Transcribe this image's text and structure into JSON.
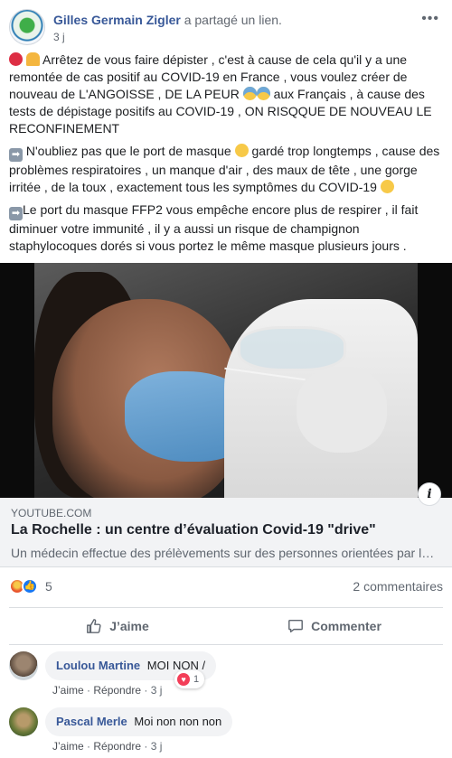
{
  "post": {
    "author": "Gilles Germain Zigler",
    "action": "a partagé un lien.",
    "time": "3 j",
    "paragraphs": [
      "Arrêtez de vous faire dépister , c'est à cause de cela qu'il y a une remontée de cas positif au COVID-19 en France , vous voulez créer de nouveau de L'ANGOISSE , DE LA PEUR",
      "aux Français , à cause des tests de dépistage positifs au COVID-19 , ON RISQQUE DE NOUVEAU LE RECONFINEMENT",
      "N'oubliez pas que le port de masque",
      "gardé trop longtemps , cause des problèmes respiratoires , un manque d'air , des maux de tête , une gorge irritée , de la toux , exactement tous les symptômes du COVID-19",
      "Le port du masque FFP2 vous empêche encore plus de respirer , il fait diminuer votre immunité , il y a aussi un risque de champignon staphylocoques dorés si vous portez le même masque plusieurs jours ."
    ]
  },
  "link_preview": {
    "source": "YOUTUBE.COM",
    "title": "La Rochelle : un centre d’évaluation Covid-19 \"drive\"",
    "description": "Un médecin effectue des prélèvements sur des personnes orientées par l…"
  },
  "reactions": {
    "count": "5",
    "comments_count": "2 commentaires",
    "types": [
      "angry-icon",
      "like-icon"
    ]
  },
  "actions": {
    "like_label": "J’aime",
    "comment_label": "Commenter"
  },
  "comments": [
    {
      "author": "Loulou Martine",
      "text": "MOI NON /",
      "like": "J’aime",
      "reply": "Répondre",
      "time": "3 j",
      "reaction_count": "1"
    },
    {
      "author": "Pascal Merle",
      "text": "Moi non non non",
      "like": "J’aime",
      "reply": "Répondre",
      "time": "3 j"
    }
  ],
  "colors": {
    "link_blue": "#385898",
    "meta_gray": "#606770",
    "like_blue": "#1877f2",
    "preview_bg": "#f2f3f5"
  }
}
